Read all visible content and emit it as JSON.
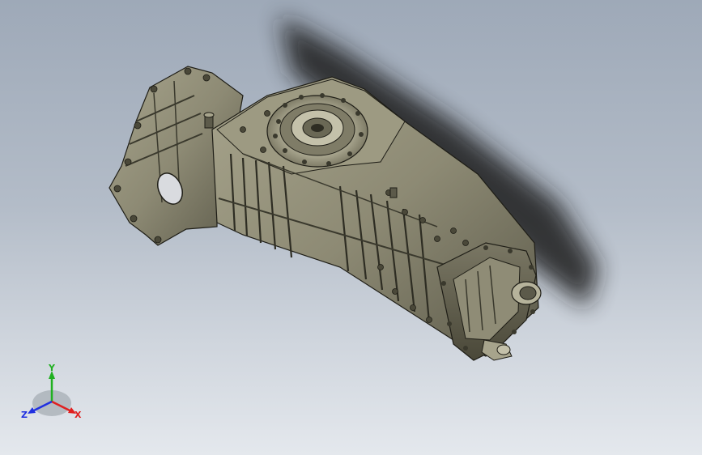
{
  "viewport": {
    "background_top": "#9ea9b8",
    "background_bottom": "#e4e8ed",
    "model": {
      "subject": "gearbox-transmission-housing",
      "body_color": "#8d8a74",
      "shadow_color": "#1a1a1a"
    }
  },
  "triad": {
    "x_label": "X",
    "y_label": "Y",
    "z_label": "Z",
    "x_color": "#e02020",
    "y_color": "#20b020",
    "z_color": "#2030e0"
  }
}
